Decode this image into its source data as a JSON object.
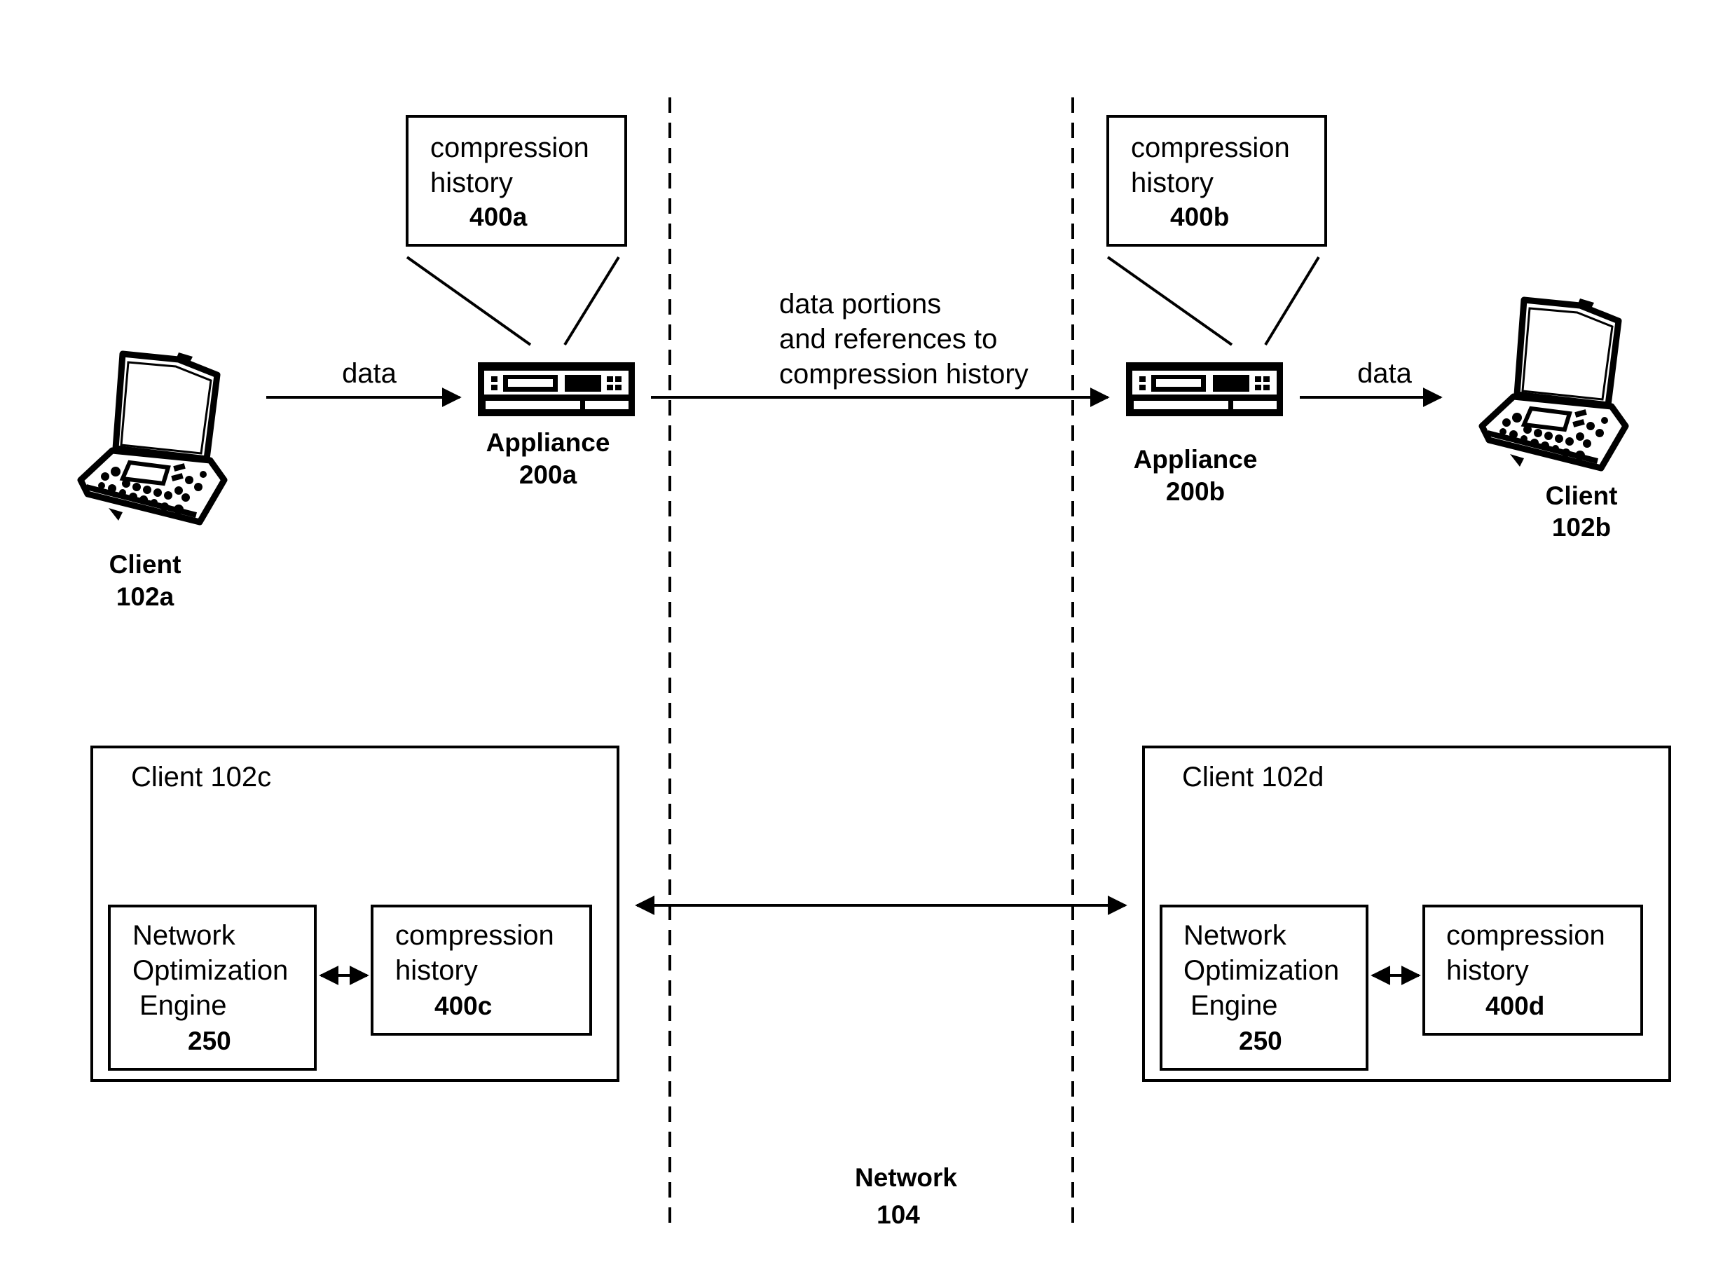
{
  "diagram": {
    "network": {
      "label": "Network",
      "number": "104"
    },
    "top": {
      "client_a": {
        "label": "Client",
        "number": "102a",
        "icon": "laptop-icon"
      },
      "client_b": {
        "label": "Client",
        "number": "102b",
        "icon": "laptop-icon"
      },
      "appliance_a": {
        "label": "Appliance",
        "number": "200a",
        "icon": "appliance-icon"
      },
      "appliance_b": {
        "label": "Appliance",
        "number": "200b",
        "icon": "appliance-icon"
      },
      "history_a": {
        "line1": "compression",
        "line2": "history",
        "number": "400a"
      },
      "history_b": {
        "line1": "compression",
        "line2": "history",
        "number": "400b"
      },
      "arrow_left_label": "data",
      "arrow_right_label": "data",
      "arrow_middle_label": [
        "data portions",
        "and references to",
        "compression history"
      ]
    },
    "bottom": {
      "client_c": {
        "title": "Client 102c",
        "engine": {
          "line1": "Network",
          "line2": "Optimization",
          "line3": "Engine",
          "number": "250"
        },
        "history": {
          "line1": "compression",
          "line2": "history",
          "number": "400c"
        }
      },
      "client_d": {
        "title": "Client 102d",
        "engine": {
          "line1": "Network",
          "line2": "Optimization",
          "line3": "Engine",
          "number": "250"
        },
        "history": {
          "line1": "compression",
          "line2": "history",
          "number": "400d"
        }
      }
    }
  }
}
